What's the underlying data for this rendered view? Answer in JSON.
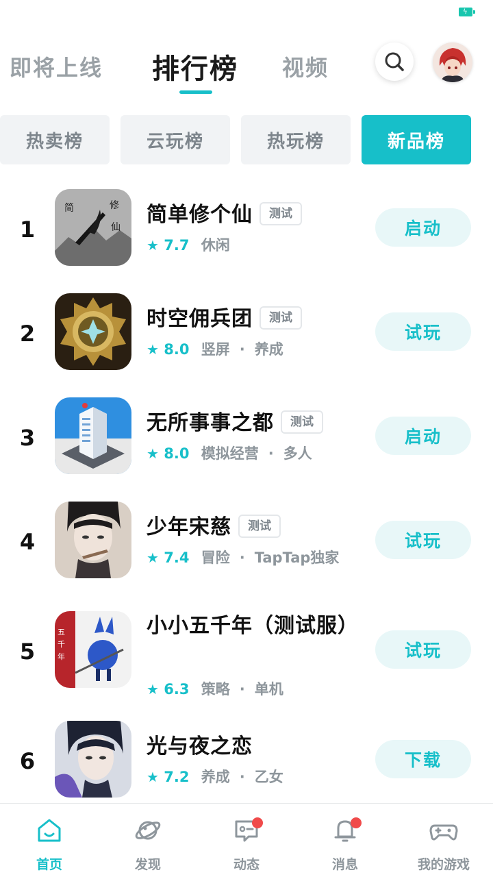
{
  "status_bar": {
    "battery_icon": "battery-charging-icon"
  },
  "top_nav": {
    "tabs": [
      {
        "label": "即将上线",
        "active": false
      },
      {
        "label": "排行榜",
        "active": true
      },
      {
        "label": "视频",
        "active": false
      }
    ],
    "search_icon": "search-icon",
    "avatar_icon": "user-avatar"
  },
  "chips": [
    {
      "label": "热卖榜",
      "active": false
    },
    {
      "label": "云玩榜",
      "active": false
    },
    {
      "label": "热玩榜",
      "active": false
    },
    {
      "label": "新品榜",
      "active": true
    }
  ],
  "games": [
    {
      "rank": "1",
      "title": "简单修个仙",
      "tag": "测试",
      "score": "7.7",
      "genres": [
        "休闲"
      ],
      "action": "启动"
    },
    {
      "rank": "2",
      "title": "时空佣兵团",
      "tag": "测试",
      "score": "8.0",
      "genres": [
        "竖屏",
        "养成"
      ],
      "action": "试玩"
    },
    {
      "rank": "3",
      "title": "无所事事之都",
      "tag": "测试",
      "score": "8.0",
      "genres": [
        "模拟经营",
        "多人"
      ],
      "action": "启动"
    },
    {
      "rank": "4",
      "title": "少年宋慈",
      "tag": "测试",
      "score": "7.4",
      "genres": [
        "冒险",
        "TapTap独家"
      ],
      "action": "试玩"
    },
    {
      "rank": "5",
      "title": "小小五千年（测试服）",
      "tag": "",
      "score": "6.3",
      "genres": [
        "策略",
        "单机"
      ],
      "action": "试玩"
    },
    {
      "rank": "6",
      "title": "光与夜之恋",
      "tag": "",
      "score": "7.2",
      "genres": [
        "养成",
        "乙女"
      ],
      "action": "下载"
    }
  ],
  "bottom_nav": [
    {
      "label": "首页",
      "icon": "home-icon",
      "active": true,
      "badge": false
    },
    {
      "label": "发现",
      "icon": "planet-icon",
      "active": false,
      "badge": false
    },
    {
      "label": "动态",
      "icon": "chat-icon",
      "active": false,
      "badge": true
    },
    {
      "label": "消息",
      "icon": "bell-icon",
      "active": false,
      "badge": true
    },
    {
      "label": "我的游戏",
      "icon": "gamepad-icon",
      "active": false,
      "badge": false
    }
  ],
  "colors": {
    "accent": "#17bfc9",
    "badge": "#f04a4a",
    "muted": "#8e969c"
  }
}
